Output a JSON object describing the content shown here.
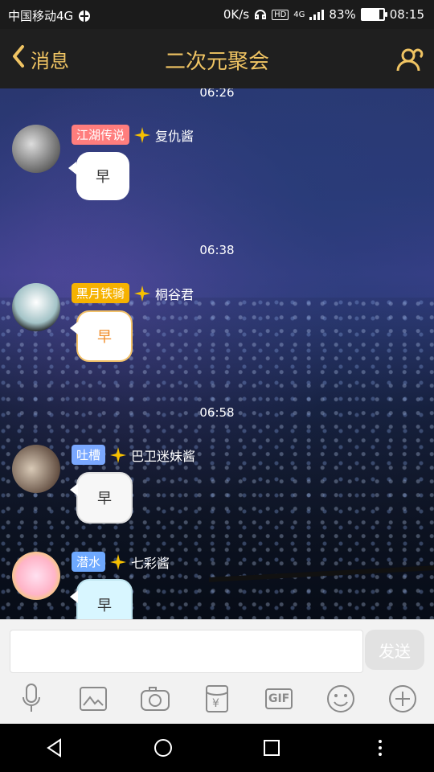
{
  "status": {
    "carrier": "中国移动4G",
    "speed": "0K/s",
    "hd": "HD",
    "signal_label": "4G",
    "battery": "83%",
    "battery_level": 0.83,
    "time": "08:15"
  },
  "titlebar": {
    "back_label": "消息",
    "title": "二次元聚会"
  },
  "chat": {
    "messages": [
      {
        "time": "06:26",
        "tag": "江湖传说",
        "tag_color": "#ff7d7d",
        "name": "复仇酱",
        "text": "早",
        "style": "white"
      },
      {
        "time": "06:38",
        "tag": "黑月铁骑",
        "tag_color": "#f6b200",
        "name": "桐谷君",
        "text": "早",
        "style": "yellow"
      },
      {
        "time": "06:58",
        "tag": "吐槽",
        "tag_color": "#7aa8ff",
        "name": "巴卫迷妹酱",
        "text": "早",
        "style": "paper"
      },
      {
        "time": "",
        "tag": "潜水",
        "tag_color": "#6ea9ff",
        "name": "七彩酱",
        "text": "早",
        "style": "cyan"
      }
    ]
  },
  "input": {
    "placeholder": "",
    "send_label": "发送",
    "tools": [
      "mic-icon",
      "image-icon",
      "camera-icon",
      "red-packet-icon",
      "gif-icon",
      "emoji-icon",
      "plus-icon"
    ],
    "gif_label": "GIF"
  },
  "colors": {
    "accent": "#f0c463",
    "title_bg": "#1f1f1f"
  }
}
